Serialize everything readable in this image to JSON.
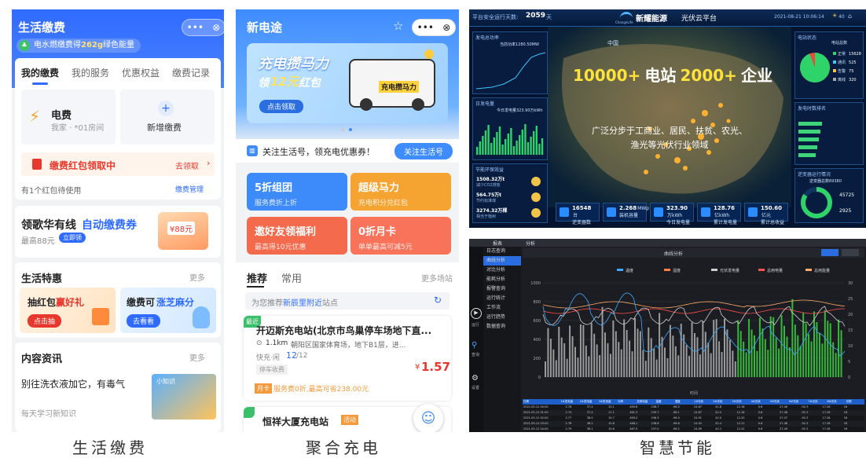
{
  "captions": [
    "生活缴费",
    "聚合充电",
    "智慧节能"
  ],
  "p1": {
    "title": "生活缴费",
    "green_text_a": "电水燃缴费得",
    "green_value": "262g",
    "green_text_b": "绿色能量",
    "tabs": [
      "我的缴费",
      "我的服务",
      "优惠权益",
      "缴费记录"
    ],
    "bill_name": "电费",
    "bill_sub": "我家 · *01房间",
    "add_label": "新增缴费",
    "redpack_label": "缴费红包领取中",
    "redpack_action": "去领取",
    "pending_text": "有1个红包待使用",
    "manage_label": "缴费管理",
    "promo_title_a": "领歌华有线",
    "promo_title_b": "自动缴费券",
    "promo_sub": "最高88元",
    "promo_btn": "立即领",
    "coupon_value": "¥88元",
    "features_title": "生活特惠",
    "features_more": "更多",
    "feat1_a": "抽红包",
    "feat1_b": "赢好礼",
    "feat1_btn": "点击抽",
    "feat2_a": "缴费可",
    "feat2_b": "涨芝麻分",
    "feat2_btn": "去看看",
    "news_title": "内容资讯",
    "news_more": "更多",
    "news_headline": "别往洗衣液加它，有毒气",
    "news_sub": "每天学习新知识",
    "news_tag": "小知识"
  },
  "p2": {
    "title": "新电途",
    "banner_l1": "充电攒马力",
    "banner_l2_a": "领",
    "banner_l2_b": "12元",
    "banner_l2_c": "红包",
    "banner_btn": "点击领取",
    "banner_badge": "充电攒马力",
    "follow_text": "关注生活号，领充电优惠券！",
    "follow_btn": "关注生活号",
    "tiles": [
      {
        "title": "5折组团",
        "sub": "服务费折上折",
        "color": "#3d8bfa"
      },
      {
        "title": "超级马力",
        "sub": "充电积分兑红包",
        "color": "#f6a431"
      },
      {
        "title": "邀好友领福利",
        "sub": "最高得10元优惠",
        "color": "#f46a4c"
      },
      {
        "title": "0折月卡",
        "sub": "单单最高可减5元",
        "color": "#f8735a"
      }
    ],
    "tabs": [
      "推荐",
      "常用"
    ],
    "more": "更多场站",
    "search_a": "为您推荐",
    "search_b": "新辰里附近",
    "search_c": "站点",
    "station1_tag": "最近",
    "station1_name": "开迈斯充电站(北京市鸟巢停车场地下直...",
    "station1_dist": "1.1km",
    "station1_addr": "朝阳区国家体育场，地下B1层，进...",
    "station1_fast_label": "快充·闲",
    "station1_fast": "12",
    "station1_fast_total": "/12",
    "station1_fee": "停车收费",
    "station1_price_sym": "¥",
    "station1_price": "1.57",
    "station1_promo_tag": "月卡",
    "station1_promo": "服务费0折,最高可省238.00元",
    "station2_name": "恒祥大厦充电站",
    "station2_tag": "活动"
  },
  "p3": {
    "days_label": "平台安全运行天数:",
    "days": "2059",
    "days_unit": "天",
    "brand": "新耀能源",
    "brand_sub": "ChangeLife",
    "platform": "光伏云平台",
    "datetime": "2021-08-21 10:06:14",
    "weather": "40",
    "headline_a": "10000+",
    "headline_b": "电站",
    "headline_c": "2000+",
    "headline_d": "企业",
    "sub_l1": "广泛分步于工商业、居民、扶贫、农光、",
    "sub_l2": "渔光等光伏行业领域",
    "left_t1": "发电总功率",
    "left_v1": "当前功率1280.50MW",
    "left_t2": "日发电量",
    "left_v2": "今日发电量323.90万kWh",
    "left_t3": "节能环保效益",
    "eco": [
      {
        "v": "1508.32万t",
        "l": "减少CO2排放"
      },
      {
        "v": "564.75万t",
        "l": "节约标准煤"
      },
      {
        "v": "3274.32万棵",
        "l": "相当于植树"
      }
    ],
    "right_t1": "电站状态",
    "right_v1": "电站总数",
    "status": [
      {
        "l": "正常",
        "v": "15628"
      },
      {
        "l": "通讯",
        "v": "525"
      },
      {
        "l": "告警",
        "v": "75"
      },
      {
        "l": "离线",
        "v": "320"
      }
    ],
    "right_t2": "发电时数排名",
    "right_t3": "逆变器运行情况",
    "right_v3": "逆变器总数69380",
    "inv": [
      {
        "v": "45725"
      },
      {
        "v": "2925"
      }
    ],
    "kpis": [
      {
        "v": "16548",
        "u": "台",
        "l": "逆变器数"
      },
      {
        "v": "2.268",
        "u": "MWp",
        "l": "装机容量"
      },
      {
        "v": "323.90",
        "u": "万kWh",
        "l": "今日发电量"
      },
      {
        "v": "128.76",
        "u": "亿kWh",
        "l": "累计发电量"
      },
      {
        "v": "150.60",
        "u": "亿元",
        "l": "累计总收益"
      }
    ],
    "pie_green_share": 0.94,
    "map_label": "中国"
  },
  "p4": {
    "menu_top": [
      "报表",
      "分析"
    ],
    "nav": [
      "日志查询",
      "曲线分析",
      "对比分析",
      "能耗分析",
      "报警查询",
      "运行统计",
      "工作流",
      "运行趋势",
      "数据查询"
    ],
    "nav_active": 1,
    "side_labels": [
      "运行",
      "查询",
      "设置"
    ],
    "chart_title": "曲线分析",
    "legend": [
      "温度",
      "湿度",
      "光伏发电量",
      "总用电量",
      "总用能量"
    ],
    "xlabel": "时间",
    "table_headers": [
      "日期",
      "1#发电量",
      "2#发电量",
      "3#发电量",
      "功率",
      "总用电量",
      "温度",
      "湿度",
      "1#光伏",
      "2#光伏",
      "3#光伏",
      "4#光伏",
      "5#光伏",
      "6#光伏",
      "7#光伏",
      "8#光伏",
      "总数"
    ],
    "table_rows": [
      [
        "2021-05-12 00:00",
        "2.76",
        "37.4",
        "10.1",
        "460.8",
        "236.7",
        "-96.5",
        "24.87",
        "41.8",
        "12.18",
        "0.6",
        "27.46",
        "-92.3",
        "17.26",
        "16"
      ],
      [
        "2021-05-12 01:00",
        "2.74",
        "37.4",
        "11.1",
        "461.3",
        "235.7",
        "-96.1",
        "24.87",
        "42.0",
        "12.18",
        "0.6",
        "27.46",
        "-92.3",
        "17.26",
        "16"
      ],
      [
        "2021-05-12 02:00",
        "2.77",
        "38.0",
        "10.7",
        "469.2",
        "236.3",
        "-96.0",
        "24.91",
        "42.0",
        "12.20",
        "0.6",
        "27.47",
        "-92.3",
        "17.26",
        "16"
      ],
      [
        "2021-05-12 03:00",
        "2.78",
        "38.2",
        "10.8",
        "468.1",
        "236.8",
        "-96.6",
        "24.92",
        "42.4",
        "12.21",
        "0.6",
        "27.48",
        "-92.3",
        "17.26",
        "16"
      ],
      [
        "2021-05-12 04:00",
        "2.79",
        "38.1",
        "10.6",
        "467.5",
        "237.0",
        "-96.2",
        "24.95",
        "42.1",
        "12.22",
        "0.6",
        "27.49",
        "-92.3",
        "17.26",
        "16"
      ]
    ],
    "y_left_ticks": [
      "1000",
      "800",
      "600",
      "400",
      "200",
      "0"
    ],
    "y_right_ticks": [
      "30",
      "25",
      "20",
      "15",
      "10",
      "5",
      "0"
    ]
  },
  "colors": {
    "alipay_blue": "#2f6bff",
    "charge_blue": "#3f8cff",
    "dash_bg": "#04142e",
    "dash_accent": "#ffcc33",
    "chart_bg": "#1b1d22",
    "green_bar": "#36b83c",
    "grey_bar": "#9a9a9a"
  }
}
